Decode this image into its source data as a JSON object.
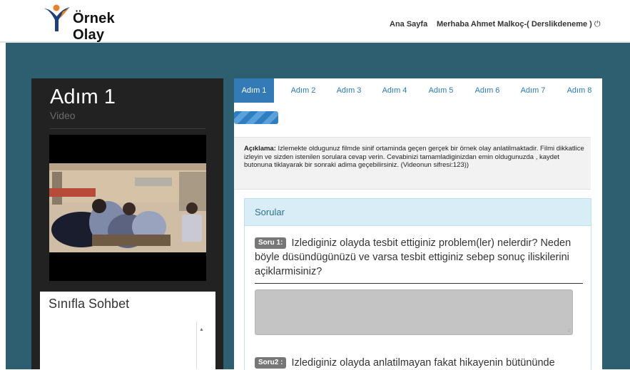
{
  "header": {
    "logo_text": "Örnek Olay",
    "nav_home": "Ana Sayfa",
    "greeting": "Merhaba Ahmet Malkoç-( Derslikdeneme )",
    "power_symbol": "⏻"
  },
  "sidebar": {
    "step_title": "Adım 1",
    "step_subtitle": "Video",
    "chat_title": "Sınıfla Sohbet",
    "scroll_arrow": "▲"
  },
  "tabs": [
    {
      "label": "Adım 1",
      "active": true
    },
    {
      "label": "Adım 2",
      "active": false
    },
    {
      "label": "Adım 3",
      "active": false
    },
    {
      "label": "Adım 4",
      "active": false
    },
    {
      "label": "Adım 5",
      "active": false
    },
    {
      "label": "Adım 6",
      "active": false
    },
    {
      "label": "Adım 7",
      "active": false
    },
    {
      "label": "Adım 8",
      "active": false
    }
  ],
  "description": {
    "label": "Açıklama:",
    "text": "Izlemekte oldugunuz filmde sinif ortaminda geçen gerçek bir örnek olay anlatilmaktadir. Filmi dikkatlice izleyin ve sizden istenilen sorulara cevap verin. Cevabinizi tamamladiginizdan emin oldugunuzda , kaydet butonuna tiklayarak bir sonraki adima geçebilirsiniz. (Videonun sifresi:123))"
  },
  "questions": {
    "heading": "Sorular",
    "items": [
      {
        "badge": "Soru 1:",
        "text": "Izlediginiz olayda tesbit ettiginiz problem(ler) nelerdir? Neden böyle düsündügünüzü ve varsa tesbit ettiginiz sebep sonuç iliskilerini açiklarmisiniz?"
      },
      {
        "badge": "Soru2 :",
        "text": "Izlediginiz olayda anlatilmayan fakat hikayenin bütününde"
      }
    ],
    "answer_grip": ".:"
  },
  "colors": {
    "accent": "#337ab7",
    "stage_bg": "#2e5f70",
    "panel_dark": "#222222",
    "info_head": "#d9edf7"
  }
}
